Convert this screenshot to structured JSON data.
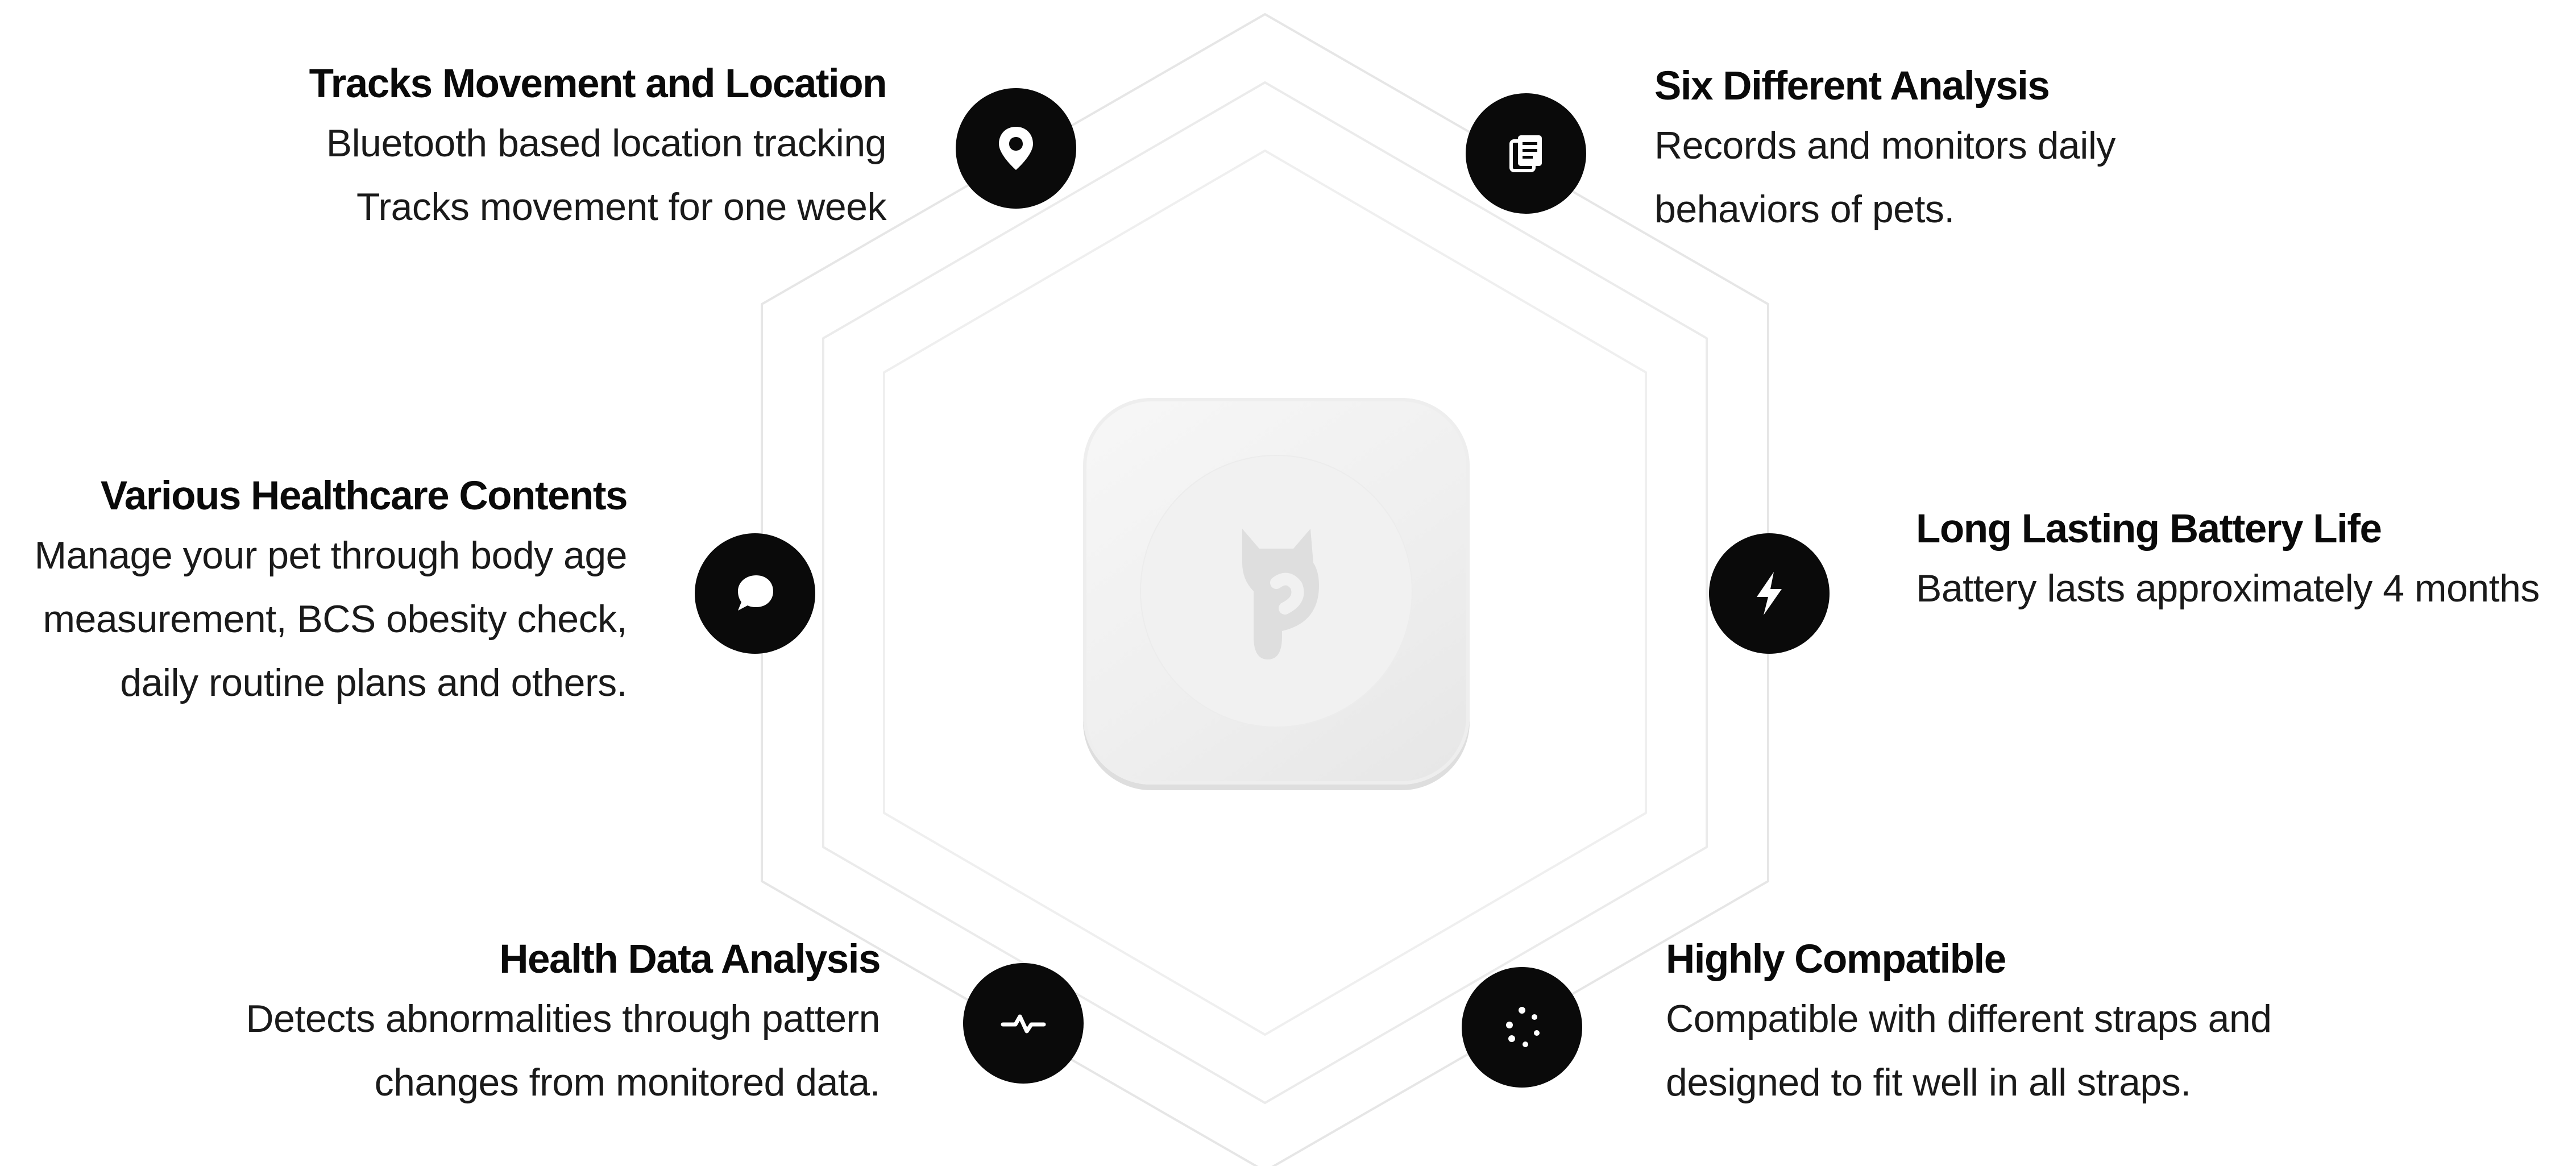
{
  "features": [
    {
      "id": "tracks-movement",
      "title": "Tracks Movement and Location",
      "lines": [
        "Bluetooth based location tracking",
        "Tracks movement for one week"
      ],
      "icon": "location-pin-icon"
    },
    {
      "id": "six-analysis",
      "title": "Six Different Analysis",
      "lines": [
        "Records and monitors daily",
        "behaviors of pets."
      ],
      "icon": "document-stack-icon"
    },
    {
      "id": "healthcare-contents",
      "title": "Various Healthcare Contents",
      "lines": [
        "Manage your pet through body age",
        "measurement, BCS obesity check,",
        "daily routine plans and others."
      ],
      "icon": "chat-bubble-icon"
    },
    {
      "id": "battery-life",
      "title": "Long Lasting Battery Life",
      "lines": [
        "Battery lasts approximately 4 months"
      ],
      "icon": "lightning-bolt-icon"
    },
    {
      "id": "health-data",
      "title": "Health Data Analysis",
      "lines": [
        "Detects abnormalities through pattern",
        "changes from monitored data."
      ],
      "icon": "pulse-icon"
    },
    {
      "id": "compatible",
      "title": "Highly Compatible",
      "lines": [
        "Compatible with different straps and",
        "designed to fit well in all straps."
      ],
      "icon": "loading-dots-icon"
    }
  ],
  "device": {
    "logo_icon": "cat-p-logo-icon"
  },
  "colors": {
    "icon_background": "#0a0a0a",
    "icon_foreground": "#ffffff",
    "hexagon_stroke": "#e4e4e4",
    "device_body": "#f2f2f2"
  }
}
